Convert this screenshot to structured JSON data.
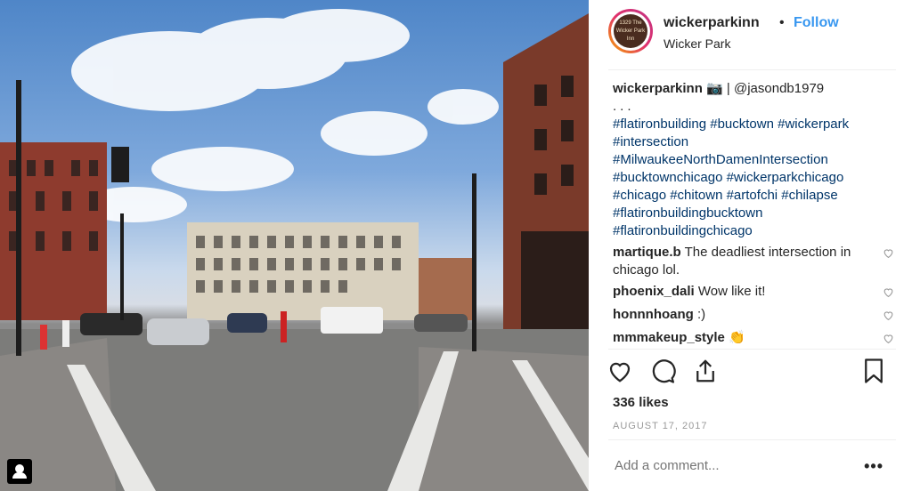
{
  "post": {
    "username": "wickerparkinn",
    "dot": "•",
    "follow_label": "Follow",
    "location": "Wicker Park",
    "avatar_text": "1329 The Wicker Park Inn"
  },
  "caption": {
    "username": "wickerparkinn",
    "camera": "📷",
    "mention": "| @jasondb1979",
    "dots": "...",
    "tags": "#flatironbuilding #bucktown #wickerpark #intersection #MilwaukeeNorthDamenIntersection #bucktownchicago #wickerparkchicago #chicago #chitown #artofchi #chilapse #flatironbuildingbucktown #flatironbuildingchicago"
  },
  "comments": [
    {
      "user": "martique.b",
      "text": "The deadliest intersection in chicago lol."
    },
    {
      "user": "phoenix_dali",
      "text": "Wow like it!"
    },
    {
      "user": "honnnhoang",
      "text": ":)"
    },
    {
      "user": "mmmakeup_style",
      "text": "👏"
    }
  ],
  "icons": {
    "like": "heart-icon",
    "comment": "comment-icon",
    "share": "share-icon",
    "save": "bookmark-icon",
    "comment_like": "heart-icon",
    "user_tag": "user-icon"
  },
  "stats": {
    "likes": "336 likes",
    "date": "AUGUST 17, 2017"
  },
  "add_comment": {
    "placeholder": "Add a comment...",
    "more": "•••"
  },
  "colors": {
    "link": "#3897f0",
    "hashtag": "#003569",
    "muted": "#999999"
  }
}
